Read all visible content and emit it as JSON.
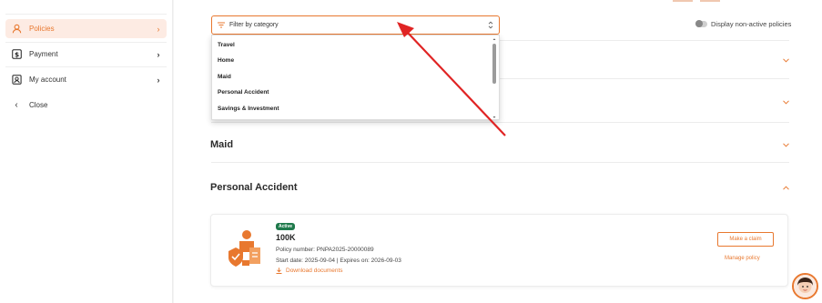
{
  "sidebar": {
    "items": [
      {
        "label": "Policies",
        "icon": "user-icon",
        "active": true
      },
      {
        "label": "Payment",
        "icon": "dollar-icon"
      },
      {
        "label": "My account",
        "icon": "account-icon"
      },
      {
        "label": "Close",
        "icon": "chevron-left-icon"
      }
    ]
  },
  "filter": {
    "placeholder": "Filter by category",
    "options": [
      "Travel",
      "Home",
      "Maid",
      "Personal Accident",
      "Savings & Investment"
    ]
  },
  "toggle_label": "Display non-active policies",
  "categories": {
    "maid": "Maid",
    "personal_accident": "Personal Accident"
  },
  "policy": {
    "status": "Active",
    "plan": "100K",
    "policy_number": "Policy number: PNPA2025-20000089",
    "dates": "Start date: 2025-09-04 | Expires on: 2026-09-03",
    "download": "Download documents",
    "make_claim": "Make a claim",
    "manage": "Manage policy"
  },
  "colors": {
    "accent": "#e8782f",
    "active_badge": "#1f7a4c",
    "annotation_arrow": "#e02424"
  }
}
